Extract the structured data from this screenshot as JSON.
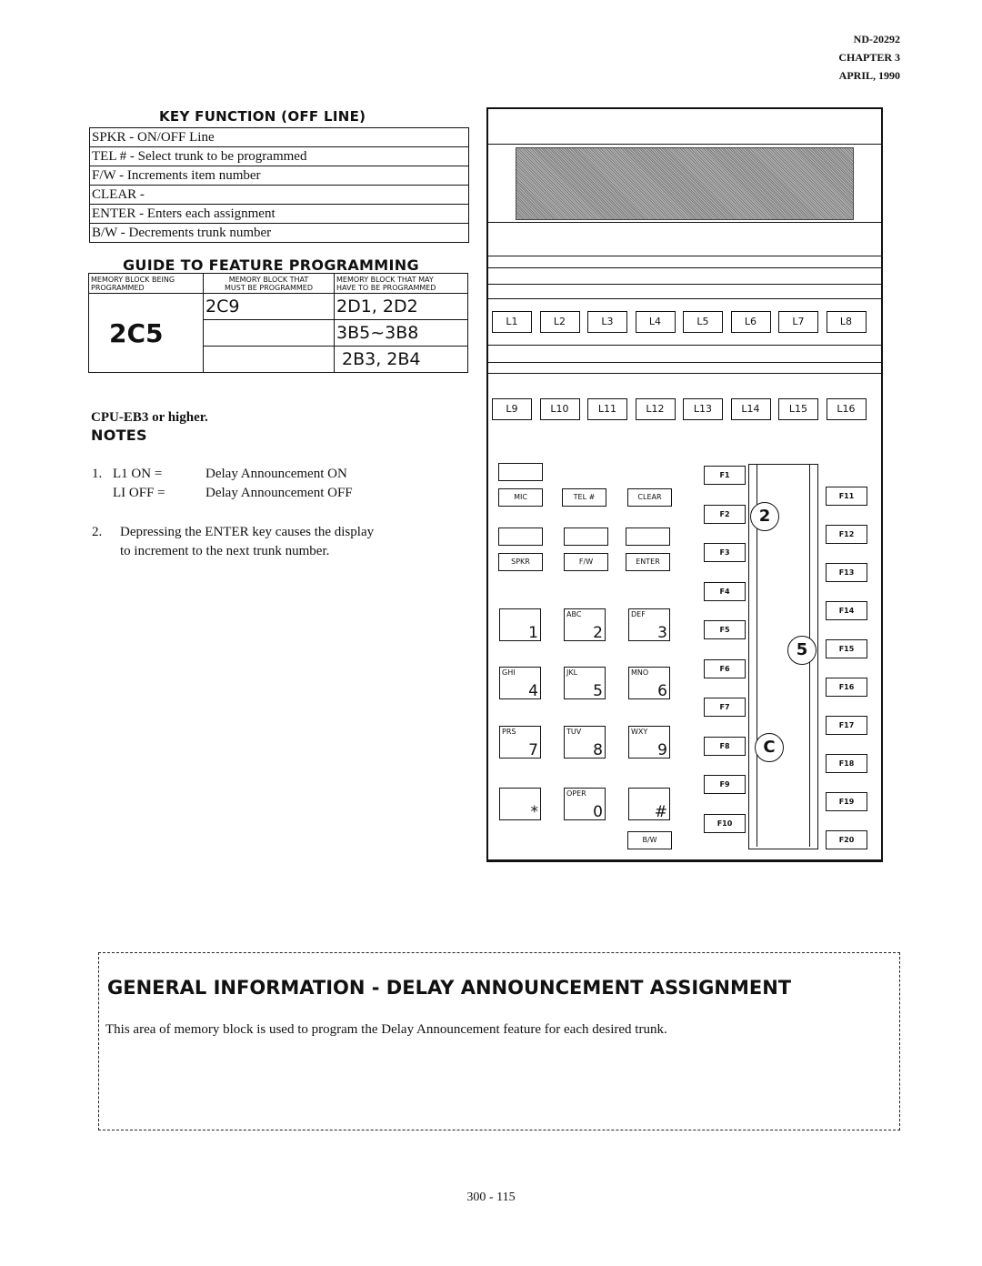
{
  "header": {
    "doc_number": "ND-20292",
    "chapter": "CHAPTER 3",
    "date": "APRIL, 1990"
  },
  "key_function": {
    "title": "KEY FUNCTION (OFF LINE)",
    "rows": [
      "SPKR - ON/OFF Line",
      "TEL # -  Select trunk to be programmed",
      "F/W - Increments item number",
      "CLEAR -",
      "ENTER -  Enters each assignment",
      "B/W - Decrements trunk number"
    ]
  },
  "guide": {
    "title": "GUIDE TO FEATURE PROGRAMMING",
    "headers": [
      [
        "MEMORY BLOCK BEING",
        "PROGRAMMED"
      ],
      [
        "MEMORY BLOCK THAT",
        "MUST BE PROGRAMMED"
      ],
      [
        "MEMORY BLOCK THAT MAY",
        "HAVE TO BE PROGRAMMED"
      ]
    ],
    "being": "2C5",
    "must": [
      "2C9",
      "",
      ""
    ],
    "may": [
      "2D1, 2D2",
      "3B5~3B8",
      "2B3, 2B4"
    ]
  },
  "cpu_note": "CPU-EB3 or higher.",
  "notes": {
    "title": "NOTES",
    "items": [
      {
        "num": "1.",
        "lines": [
          [
            "L1 ON =",
            "Delay Announcement ON"
          ],
          [
            "LI OFF =",
            "Delay Announcement OFF"
          ]
        ]
      },
      {
        "num": "2.",
        "text1": "Depressing the ENTER key causes the display",
        "text2": "to increment to the next trunk number."
      }
    ]
  },
  "phone": {
    "line_keys_1": [
      "L1",
      "L2",
      "L3",
      "L4",
      "L5",
      "L6",
      "L7",
      "L8"
    ],
    "line_keys_2": [
      "L9",
      "L10",
      "L11",
      "L12",
      "L13",
      "L14",
      "L15",
      "L16"
    ],
    "function_keys": {
      "mic": "MIC",
      "tel": "TEL #",
      "clear": "CLEAR",
      "spkr": "SPKR",
      "fw": "F/W",
      "enter": "ENTER",
      "bw": "B/W"
    },
    "dial": [
      [
        "",
        "1"
      ],
      [
        "ABC",
        "2"
      ],
      [
        "DEF",
        "3"
      ],
      [
        "GHI",
        "4"
      ],
      [
        "JKL",
        "5"
      ],
      [
        "MNO",
        "6"
      ],
      [
        "PRS",
        "7"
      ],
      [
        "TUV",
        "8"
      ],
      [
        "WXY",
        "9"
      ],
      [
        "",
        "*"
      ],
      [
        "OPER",
        "0"
      ],
      [
        "",
        "#"
      ]
    ],
    "f_left": [
      "F1",
      "F2",
      "F3",
      "F4",
      "F5",
      "F6",
      "F7",
      "F8",
      "F9",
      "F10"
    ],
    "f_right": [
      "F11",
      "F12",
      "F13",
      "F14",
      "F15",
      "F16",
      "F17",
      "F18",
      "F19",
      "F20"
    ],
    "markers": [
      "2",
      "5",
      "C"
    ]
  },
  "general": {
    "title": "GENERAL INFORMATION  -  DELAY ANNOUNCEMENT ASSIGNMENT",
    "text": "This area of memory block is used to program the Delay Announcement feature for each desired trunk."
  },
  "page_number": "300 - 115"
}
